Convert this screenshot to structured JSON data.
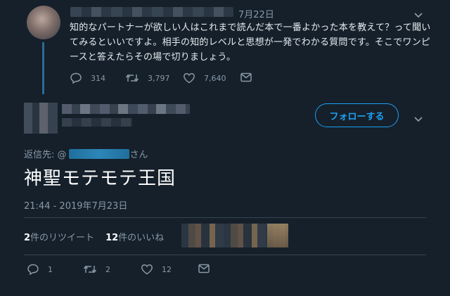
{
  "parent_tweet": {
    "date": "7月22日",
    "text": "知的なパートナーが欲しい人はこれまで読んだ本で一番よかった本を教えて？って聞いてみるといいですよ。相手の知的レベルと思想が一発でわかる質問です。そこでワンピースと答えたらその場で切りましょう。",
    "replies": "314",
    "retweets": "3,797",
    "likes": "7,640"
  },
  "main_tweet": {
    "follow_label": "フォローする",
    "reply_prefix": "返信先: @",
    "reply_suffix": "さん",
    "text": "神聖モテモテ王国",
    "timestamp": "21:44 - 2019年7月23日",
    "retweet_count": "2",
    "retweet_label": "件のリツイート",
    "like_count": "12",
    "like_label": "件のいいね",
    "replies": "1",
    "retweets": "2",
    "likes": "12"
  },
  "colors": {
    "background": "#15202b",
    "accent": "#1da1f2",
    "muted": "#8899a6",
    "thread_line": "#2d6a96"
  },
  "icons": [
    "reply-icon",
    "retweet-icon",
    "like-icon",
    "direct-message-icon",
    "chevron-down-icon"
  ]
}
